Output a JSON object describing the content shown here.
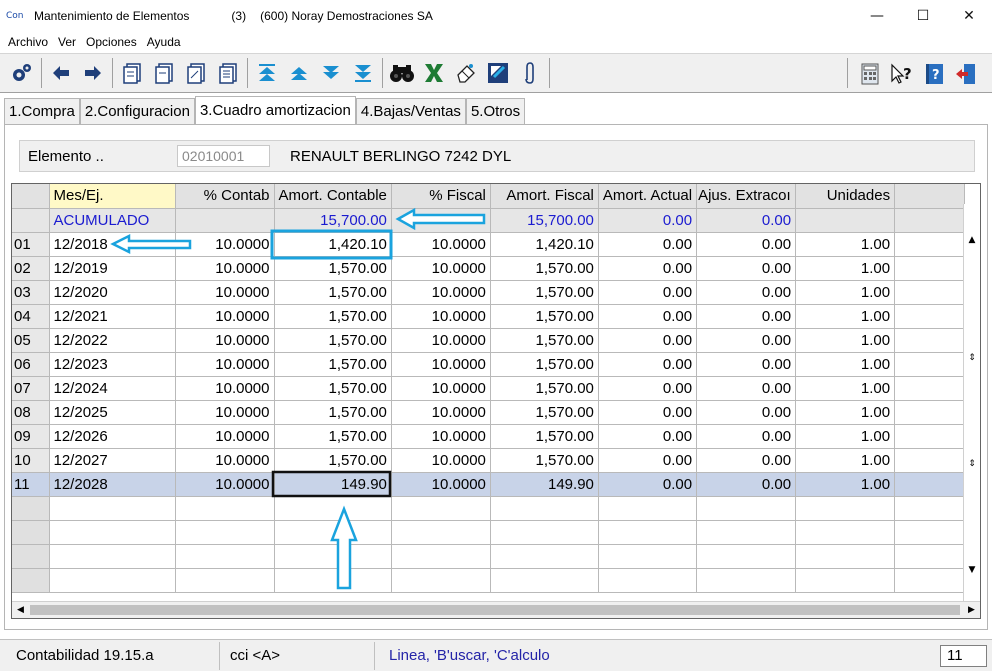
{
  "window": {
    "app_icon": "Con",
    "title": "Mantenimiento de Elementos",
    "count": "(3)",
    "company": "(600) Noray Demostraciones SA",
    "minimize": "—",
    "maximize": "☐",
    "close": "✕"
  },
  "menu": {
    "items": [
      {
        "label": "Archivo"
      },
      {
        "label": "Ver"
      },
      {
        "label": "Opciones"
      },
      {
        "label": "Ayuda"
      }
    ]
  },
  "toolbar": {
    "icons": [
      "gears-icon",
      "back-arrow-icon",
      "forward-arrow-icon",
      "copy-doc-icon",
      "paste-doc-icon",
      "edit-doc-icon",
      "list-doc-icon",
      "first-record-icon",
      "previous-record-icon",
      "next-record-icon",
      "last-record-icon",
      "binoculars-icon",
      "excel-icon",
      "eraser-icon",
      "zoom-icon",
      "attach-icon"
    ],
    "right_icons": [
      "calculator-icon",
      "help-pointer-icon",
      "help-book-icon",
      "exit-icon"
    ]
  },
  "tabs": [
    {
      "label": "1.Compra"
    },
    {
      "label": "2.Configuracion"
    },
    {
      "label": "3.Cuadro amortizacion"
    },
    {
      "label": "4.Bajas/Ventas"
    },
    {
      "label": "5.Otros"
    }
  ],
  "element": {
    "label": "Elemento ..",
    "code": "02010001",
    "description": "RENAULT BERLINGO 7242 DYL"
  },
  "grid": {
    "columns": [
      "Mes/Ej.",
      "% Contab",
      "Amort. Contable",
      "% Fiscal",
      "Amort. Fiscal",
      "Amort. Actual",
      "Ajus. Extracoı",
      "Unidades"
    ],
    "accumulated": {
      "label": "ACUMULADO",
      "amort_contable": "15,700.00",
      "amort_fiscal": "15,700.00",
      "amort_actual": "0.00",
      "ajus_extra": "0.00"
    },
    "rows": [
      {
        "n": "01",
        "mes": "12/2018",
        "pct_contab": "10.0000",
        "amort_contable": "1,420.10",
        "pct_fiscal": "10.0000",
        "amort_fiscal": "1,420.10",
        "amort_actual": "0.00",
        "ajus": "0.00",
        "unidades": "1.00"
      },
      {
        "n": "02",
        "mes": "12/2019",
        "pct_contab": "10.0000",
        "amort_contable": "1,570.00",
        "pct_fiscal": "10.0000",
        "amort_fiscal": "1,570.00",
        "amort_actual": "0.00",
        "ajus": "0.00",
        "unidades": "1.00"
      },
      {
        "n": "03",
        "mes": "12/2020",
        "pct_contab": "10.0000",
        "amort_contable": "1,570.00",
        "pct_fiscal": "10.0000",
        "amort_fiscal": "1,570.00",
        "amort_actual": "0.00",
        "ajus": "0.00",
        "unidades": "1.00"
      },
      {
        "n": "04",
        "mes": "12/2021",
        "pct_contab": "10.0000",
        "amort_contable": "1,570.00",
        "pct_fiscal": "10.0000",
        "amort_fiscal": "1,570.00",
        "amort_actual": "0.00",
        "ajus": "0.00",
        "unidades": "1.00"
      },
      {
        "n": "05",
        "mes": "12/2022",
        "pct_contab": "10.0000",
        "amort_contable": "1,570.00",
        "pct_fiscal": "10.0000",
        "amort_fiscal": "1,570.00",
        "amort_actual": "0.00",
        "ajus": "0.00",
        "unidades": "1.00"
      },
      {
        "n": "06",
        "mes": "12/2023",
        "pct_contab": "10.0000",
        "amort_contable": "1,570.00",
        "pct_fiscal": "10.0000",
        "amort_fiscal": "1,570.00",
        "amort_actual": "0.00",
        "ajus": "0.00",
        "unidades": "1.00"
      },
      {
        "n": "07",
        "mes": "12/2024",
        "pct_contab": "10.0000",
        "amort_contable": "1,570.00",
        "pct_fiscal": "10.0000",
        "amort_fiscal": "1,570.00",
        "amort_actual": "0.00",
        "ajus": "0.00",
        "unidades": "1.00"
      },
      {
        "n": "08",
        "mes": "12/2025",
        "pct_contab": "10.0000",
        "amort_contable": "1,570.00",
        "pct_fiscal": "10.0000",
        "amort_fiscal": "1,570.00",
        "amort_actual": "0.00",
        "ajus": "0.00",
        "unidades": "1.00"
      },
      {
        "n": "09",
        "mes": "12/2026",
        "pct_contab": "10.0000",
        "amort_contable": "1,570.00",
        "pct_fiscal": "10.0000",
        "amort_fiscal": "1,570.00",
        "amort_actual": "0.00",
        "ajus": "0.00",
        "unidades": "1.00"
      },
      {
        "n": "10",
        "mes": "12/2027",
        "pct_contab": "10.0000",
        "amort_contable": "1,570.00",
        "pct_fiscal": "10.0000",
        "amort_fiscal": "1,570.00",
        "amort_actual": "0.00",
        "ajus": "0.00",
        "unidades": "1.00"
      },
      {
        "n": "11",
        "mes": "12/2028",
        "pct_contab": "10.0000",
        "amort_contable": "149.90",
        "pct_fiscal": "10.0000",
        "amort_fiscal": "149.90",
        "amort_actual": "0.00",
        "ajus": "0.00",
        "unidades": "1.00"
      }
    ],
    "selected_row": "11",
    "empty_rows": 4
  },
  "status": {
    "app": "Contabilidad 19.15.a",
    "mode": "cci <A>",
    "hint": "Linea, 'B'uscar, 'C'alculo",
    "count": "11"
  },
  "colors": {
    "accent_blue": "#1b1bd0",
    "annotation": "#1aa3de",
    "selected_row": "#c8d3e8",
    "header_first": "#fff9c7"
  }
}
